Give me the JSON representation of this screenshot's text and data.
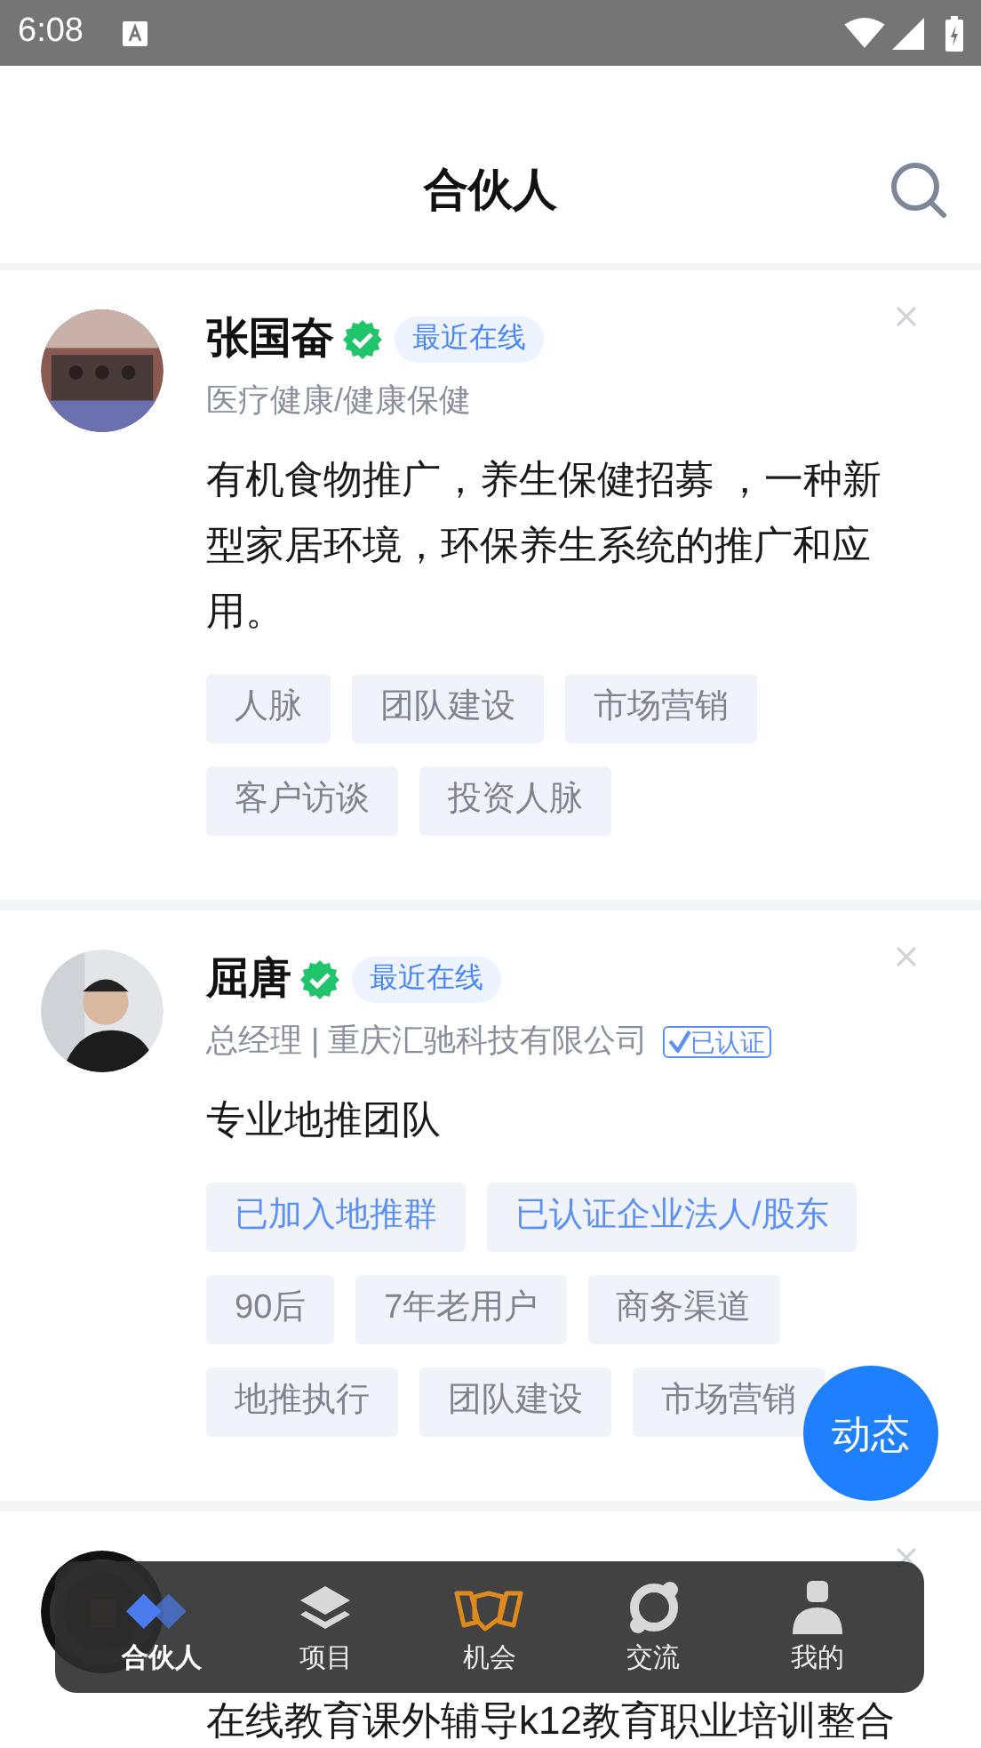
{
  "status_bar": {
    "time": "6:08"
  },
  "header": {
    "title": "合伙人"
  },
  "partners": [
    {
      "name": "张国奋",
      "verified": true,
      "status": "最近在线",
      "subtitle": "医疗健康/健康保健",
      "bio": "有机食物推广，养生保健招募 ，一种新型家居环境，环保养生系统的推广和应用。",
      "tags": [
        {
          "label": "人脉",
          "kind": "plain"
        },
        {
          "label": "团队建设",
          "kind": "plain"
        },
        {
          "label": "市场营销",
          "kind": "plain"
        },
        {
          "label": "客户访谈",
          "kind": "plain"
        },
        {
          "label": "投资人脉",
          "kind": "plain"
        }
      ]
    },
    {
      "name": "屈唐",
      "verified": true,
      "status": "最近在线",
      "subtitle": "总经理 | 重庆汇驰科技有限公司",
      "certified": "已认证",
      "bio": "专业地推团队",
      "tags": [
        {
          "label": "已加入地推群",
          "kind": "highlight"
        },
        {
          "label": "已认证企业法人/股东",
          "kind": "highlight"
        },
        {
          "label": "90后",
          "kind": "plain"
        },
        {
          "label": "7年老用户",
          "kind": "plain"
        },
        {
          "label": "商务渠道",
          "kind": "plain"
        },
        {
          "label": "地推执行",
          "kind": "plain"
        },
        {
          "label": "团队建设",
          "kind": "plain"
        },
        {
          "label": "市场营销",
          "kind": "plain"
        }
      ]
    },
    {
      "bio": "在线教育课外辅导k12教育职业培训整合"
    }
  ],
  "fab": {
    "label": "动态"
  },
  "bottom_nav": [
    {
      "label": "合伙人",
      "selected": true
    },
    {
      "label": "项目",
      "selected": false
    },
    {
      "label": "机会",
      "selected": false
    },
    {
      "label": "交流",
      "selected": false
    },
    {
      "label": "我的",
      "selected": false
    }
  ]
}
